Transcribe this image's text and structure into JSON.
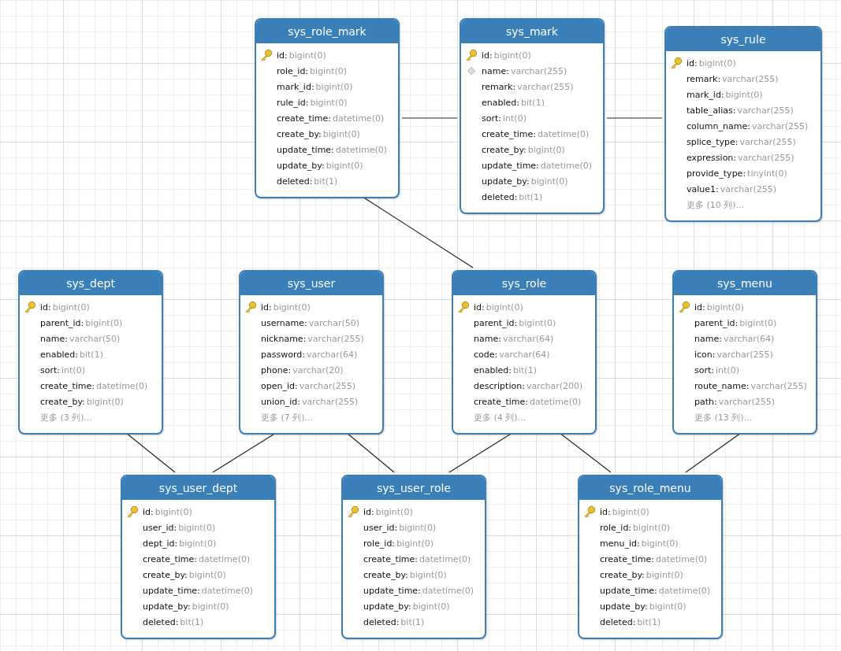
{
  "tables": [
    {
      "title": "sys_role_mark",
      "columns": [
        {
          "kind": "key",
          "name": "id:",
          "type": "bigint(0)"
        },
        {
          "kind": "plain",
          "name": "role_id:",
          "type": "bigint(0)"
        },
        {
          "kind": "plain",
          "name": "mark_id:",
          "type": "bigint(0)"
        },
        {
          "kind": "plain",
          "name": "rule_id:",
          "type": "bigint(0)"
        },
        {
          "kind": "plain",
          "name": "create_time:",
          "type": "datetime(0)"
        },
        {
          "kind": "plain",
          "name": "create_by:",
          "type": "bigint(0)"
        },
        {
          "kind": "plain",
          "name": "update_time:",
          "type": "datetime(0)"
        },
        {
          "kind": "plain",
          "name": "update_by:",
          "type": "bigint(0)"
        },
        {
          "kind": "plain",
          "name": "deleted:",
          "type": "bit(1)"
        }
      ]
    },
    {
      "title": "sys_mark",
      "columns": [
        {
          "kind": "key",
          "name": "id:",
          "type": "bigint(0)"
        },
        {
          "kind": "index",
          "name": "name:",
          "type": "varchar(255)"
        },
        {
          "kind": "plain",
          "name": "remark:",
          "type": "varchar(255)"
        },
        {
          "kind": "plain",
          "name": "enabled:",
          "type": "bit(1)"
        },
        {
          "kind": "plain",
          "name": "sort:",
          "type": "int(0)"
        },
        {
          "kind": "plain",
          "name": "create_time:",
          "type": "datetime(0)"
        },
        {
          "kind": "plain",
          "name": "create_by:",
          "type": "bigint(0)"
        },
        {
          "kind": "plain",
          "name": "update_time:",
          "type": "datetime(0)"
        },
        {
          "kind": "plain",
          "name": "update_by:",
          "type": "bigint(0)"
        },
        {
          "kind": "plain",
          "name": "deleted:",
          "type": "bit(1)"
        }
      ]
    },
    {
      "title": "sys_rule",
      "columns": [
        {
          "kind": "key",
          "name": "id:",
          "type": "bigint(0)"
        },
        {
          "kind": "plain",
          "name": "remark:",
          "type": "varchar(255)"
        },
        {
          "kind": "plain",
          "name": "mark_id:",
          "type": "bigint(0)"
        },
        {
          "kind": "plain",
          "name": "table_alias:",
          "type": "varchar(255)"
        },
        {
          "kind": "plain",
          "name": "column_name:",
          "type": "varchar(255)"
        },
        {
          "kind": "plain",
          "name": "splice_type:",
          "type": "varchar(255)"
        },
        {
          "kind": "plain",
          "name": "expression:",
          "type": "varchar(255)"
        },
        {
          "kind": "plain",
          "name": "provide_type:",
          "type": "tinyint(0)"
        },
        {
          "kind": "plain",
          "name": "value1:",
          "type": "varchar(255)"
        }
      ],
      "more": "更多 (10 列)..."
    },
    {
      "title": "sys_dept",
      "columns": [
        {
          "kind": "key",
          "name": "id:",
          "type": "bigint(0)"
        },
        {
          "kind": "plain",
          "name": "parent_id:",
          "type": "bigint(0)"
        },
        {
          "kind": "plain",
          "name": "name:",
          "type": "varchar(50)"
        },
        {
          "kind": "plain",
          "name": "enabled:",
          "type": "bit(1)"
        },
        {
          "kind": "plain",
          "name": "sort:",
          "type": "int(0)"
        },
        {
          "kind": "plain",
          "name": "create_time:",
          "type": "datetime(0)"
        },
        {
          "kind": "plain",
          "name": "create_by:",
          "type": "bigint(0)"
        }
      ],
      "more": "更多 (3 列)..."
    },
    {
      "title": "sys_user",
      "columns": [
        {
          "kind": "key",
          "name": "id:",
          "type": "bigint(0)"
        },
        {
          "kind": "plain",
          "name": "username:",
          "type": "varchar(50)"
        },
        {
          "kind": "plain",
          "name": "nickname:",
          "type": "varchar(255)"
        },
        {
          "kind": "plain",
          "name": "password:",
          "type": "varchar(64)"
        },
        {
          "kind": "plain",
          "name": "phone:",
          "type": "varchar(20)"
        },
        {
          "kind": "plain",
          "name": "open_id:",
          "type": "varchar(255)"
        },
        {
          "kind": "plain",
          "name": "union_id:",
          "type": "varchar(255)"
        }
      ],
      "more": "更多 (7 列)..."
    },
    {
      "title": "sys_role",
      "columns": [
        {
          "kind": "key",
          "name": "id:",
          "type": "bigint(0)"
        },
        {
          "kind": "plain",
          "name": "parent_id:",
          "type": "bigint(0)"
        },
        {
          "kind": "plain",
          "name": "name:",
          "type": "varchar(64)"
        },
        {
          "kind": "plain",
          "name": "code:",
          "type": "varchar(64)"
        },
        {
          "kind": "plain",
          "name": "enabled:",
          "type": "bit(1)"
        },
        {
          "kind": "plain",
          "name": "description:",
          "type": "varchar(200)"
        },
        {
          "kind": "plain",
          "name": "create_time:",
          "type": "datetime(0)"
        }
      ],
      "more": "更多 (4 列)..."
    },
    {
      "title": "sys_menu",
      "columns": [
        {
          "kind": "key",
          "name": "id:",
          "type": "bigint(0)"
        },
        {
          "kind": "plain",
          "name": "parent_id:",
          "type": "bigint(0)"
        },
        {
          "kind": "plain",
          "name": "name:",
          "type": "varchar(64)"
        },
        {
          "kind": "plain",
          "name": "icon:",
          "type": "varchar(255)"
        },
        {
          "kind": "plain",
          "name": "sort:",
          "type": "int(0)"
        },
        {
          "kind": "plain",
          "name": "route_name:",
          "type": "varchar(255)"
        },
        {
          "kind": "plain",
          "name": "path:",
          "type": "varchar(255)"
        }
      ],
      "more": "更多 (13 列)..."
    },
    {
      "title": "sys_user_dept",
      "columns": [
        {
          "kind": "key",
          "name": "id:",
          "type": "bigint(0)"
        },
        {
          "kind": "plain",
          "name": "user_id:",
          "type": "bigint(0)"
        },
        {
          "kind": "plain",
          "name": "dept_id:",
          "type": "bigint(0)"
        },
        {
          "kind": "plain",
          "name": "create_time:",
          "type": "datetime(0)"
        },
        {
          "kind": "plain",
          "name": "create_by:",
          "type": "bigint(0)"
        },
        {
          "kind": "plain",
          "name": "update_time:",
          "type": "datetime(0)"
        },
        {
          "kind": "plain",
          "name": "update_by:",
          "type": "bigint(0)"
        },
        {
          "kind": "plain",
          "name": "deleted:",
          "type": "bit(1)"
        }
      ]
    },
    {
      "title": "sys_user_role",
      "columns": [
        {
          "kind": "key",
          "name": "id:",
          "type": "bigint(0)"
        },
        {
          "kind": "plain",
          "name": "user_id:",
          "type": "bigint(0)"
        },
        {
          "kind": "plain",
          "name": "role_id:",
          "type": "bigint(0)"
        },
        {
          "kind": "plain",
          "name": "create_time:",
          "type": "datetime(0)"
        },
        {
          "kind": "plain",
          "name": "create_by:",
          "type": "bigint(0)"
        },
        {
          "kind": "plain",
          "name": "update_time:",
          "type": "datetime(0)"
        },
        {
          "kind": "plain",
          "name": "update_by:",
          "type": "bigint(0)"
        },
        {
          "kind": "plain",
          "name": "deleted:",
          "type": "bit(1)"
        }
      ]
    },
    {
      "title": "sys_role_menu",
      "columns": [
        {
          "kind": "key",
          "name": "id:",
          "type": "bigint(0)"
        },
        {
          "kind": "plain",
          "name": "role_id:",
          "type": "bigint(0)"
        },
        {
          "kind": "plain",
          "name": "menu_id:",
          "type": "bigint(0)"
        },
        {
          "kind": "plain",
          "name": "create_time:",
          "type": "datetime(0)"
        },
        {
          "kind": "plain",
          "name": "create_by:",
          "type": "bigint(0)"
        },
        {
          "kind": "plain",
          "name": "update_time:",
          "type": "datetime(0)"
        },
        {
          "kind": "plain",
          "name": "update_by:",
          "type": "bigint(0)"
        },
        {
          "kind": "plain",
          "name": "deleted:",
          "type": "bit(1)"
        }
      ]
    }
  ]
}
